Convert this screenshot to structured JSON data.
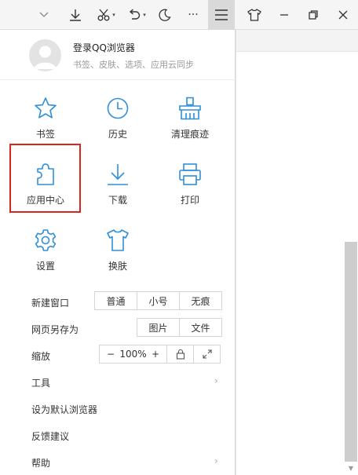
{
  "toolbar": {
    "undo_caret": "▾",
    "cut_caret": "▾",
    "more_label": "···"
  },
  "menu": {
    "login": {
      "title": "登录QQ浏览器",
      "subtitle": "书签、皮肤、选项、应用云同步"
    },
    "grid": [
      {
        "label": "书签",
        "icon": "star-icon"
      },
      {
        "label": "历史",
        "icon": "clock-icon"
      },
      {
        "label": "清理痕迹",
        "icon": "broom-icon"
      },
      {
        "label": "应用中心",
        "icon": "puzzle-icon"
      },
      {
        "label": "下载",
        "icon": "download-icon"
      },
      {
        "label": "打印",
        "icon": "printer-icon"
      },
      {
        "label": "设置",
        "icon": "gear-icon"
      },
      {
        "label": "换肤",
        "icon": "tshirt-icon"
      }
    ],
    "new_window": {
      "label": "新建窗口",
      "options": [
        "普通",
        "小号",
        "无痕"
      ]
    },
    "save_as": {
      "label": "网页另存为",
      "options": [
        "图片",
        "文件"
      ]
    },
    "zoom": {
      "label": "缩放",
      "minus": "−",
      "value": "100%",
      "plus": "+"
    },
    "rows": [
      {
        "label": "工具",
        "has_arrow": true
      },
      {
        "label": "设为默认浏览器",
        "has_arrow": false
      },
      {
        "label": "反馈建议",
        "has_arrow": false
      },
      {
        "label": "帮助",
        "has_arrow": true
      }
    ],
    "chevron": "›"
  },
  "colors": {
    "icon_blue": "#2f8fd8",
    "highlight_red": "#d9251d"
  }
}
